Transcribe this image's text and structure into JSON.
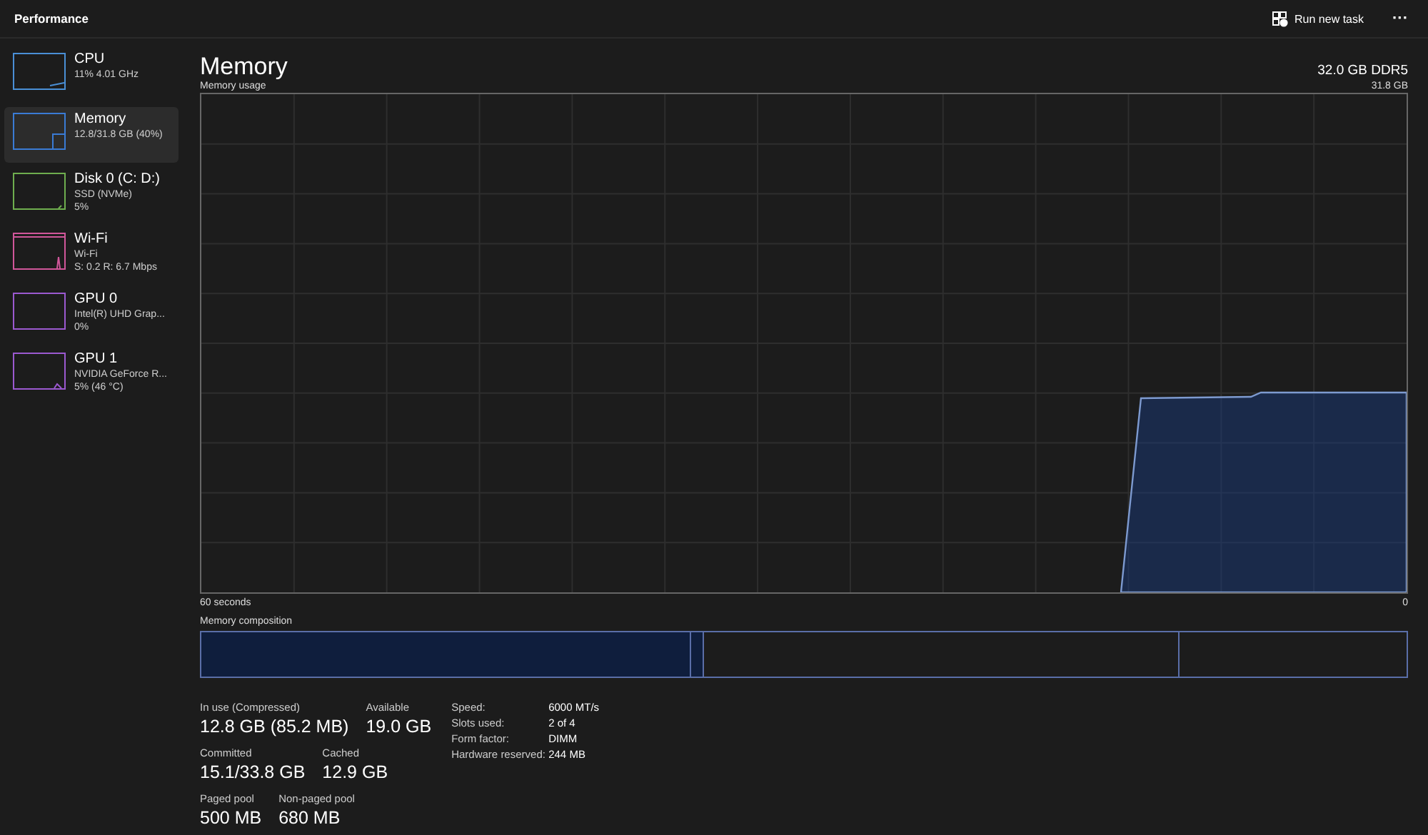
{
  "window": {
    "title": "Performance"
  },
  "toolbar": {
    "run_task": "Run new task",
    "more": "···"
  },
  "sidebar": {
    "items": [
      {
        "name": "CPU",
        "lines": [
          "11% 4.01 GHz"
        ],
        "selected": false,
        "color": "#4a8fd6"
      },
      {
        "name": "Memory",
        "lines": [
          "12.8/31.8 GB (40%)"
        ],
        "selected": true,
        "color": "#3a7bd5"
      },
      {
        "name": "Disk 0 (C: D:)",
        "lines": [
          "SSD (NVMe)",
          "5%"
        ],
        "selected": false,
        "color": "#6fae4f"
      },
      {
        "name": "Wi-Fi",
        "lines": [
          "Wi-Fi",
          "S: 0.2 R: 6.7 Mbps"
        ],
        "selected": false,
        "color": "#d0569a"
      },
      {
        "name": "GPU 0",
        "lines": [
          "Intel(R) UHD Grap...",
          "0%"
        ],
        "selected": false,
        "color": "#9b59d0"
      },
      {
        "name": "GPU 1",
        "lines": [
          "NVIDIA GeForce R...",
          "5% (46 °C)"
        ],
        "selected": false,
        "color": "#9b59d0"
      }
    ]
  },
  "main": {
    "title": "Memory",
    "spec": "32.0 GB DDR5",
    "graph": {
      "label": "Memory usage",
      "max_label": "31.8 GB",
      "left_label": "60 seconds",
      "right_label": "0"
    },
    "composition": {
      "label": "Memory composition"
    },
    "stats": [
      [
        {
          "label": "In use (Compressed)",
          "value": "12.8 GB (85.2 MB)"
        },
        {
          "label": "Available",
          "value": "19.0 GB"
        }
      ],
      [
        {
          "label": "Committed",
          "value": "15.1/33.8 GB"
        },
        {
          "label": "Cached",
          "value": "12.9 GB"
        }
      ],
      [
        {
          "label": "Paged pool",
          "value": "500 MB"
        },
        {
          "label": "Non-paged pool",
          "value": "680 MB"
        }
      ]
    ],
    "details": [
      {
        "label": "Speed:",
        "value": "6000 MT/s"
      },
      {
        "label": "Slots used:",
        "value": "2 of 4"
      },
      {
        "label": "Form factor:",
        "value": "DIMM"
      },
      {
        "label": "Hardware reserved:",
        "value": "244 MB"
      }
    ]
  }
}
